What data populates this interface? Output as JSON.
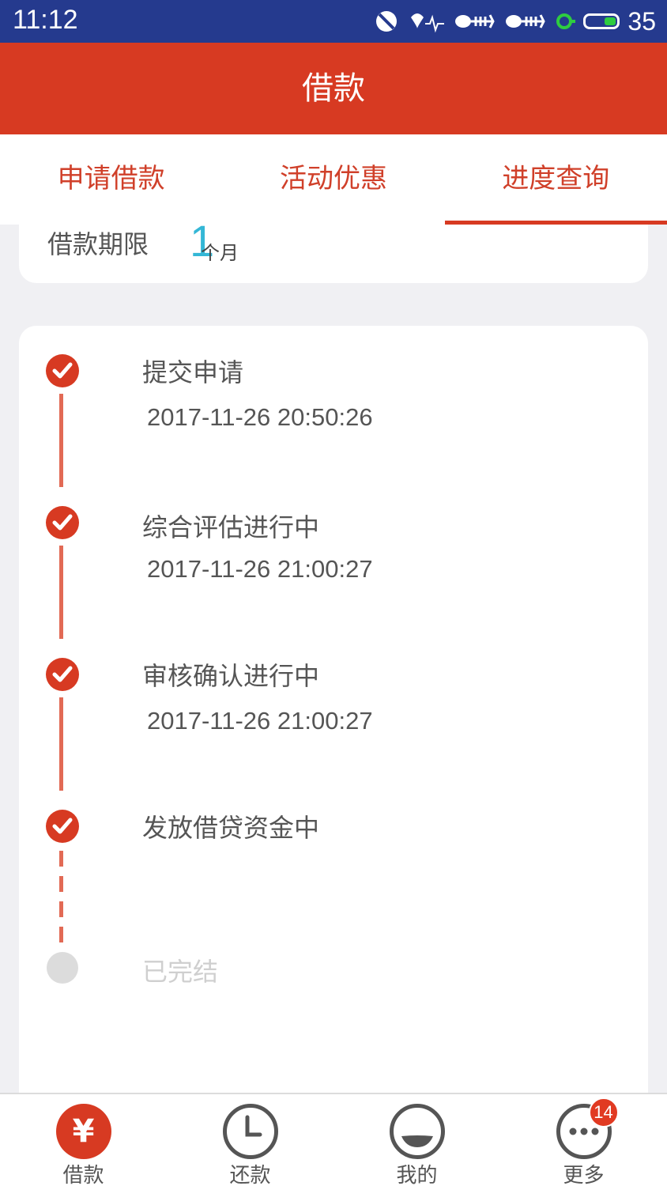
{
  "status_bar": {
    "time": "11:12",
    "battery_level": "35",
    "icons": [
      "signal-icon",
      "wifi-icon",
      "fish-icon",
      "fish-icon",
      "battery-icon"
    ]
  },
  "header": {
    "title": "借款"
  },
  "tabs": [
    {
      "label": "申请借款",
      "active": false
    },
    {
      "label": "活动优惠",
      "active": false
    },
    {
      "label": "进度查询",
      "active": true
    }
  ],
  "loan_term": {
    "label": "借款期限",
    "value": "1",
    "unit": "个月"
  },
  "progress": {
    "steps": [
      {
        "title": "提交申请",
        "time": "2017-11-26 20:50:26",
        "done": true
      },
      {
        "title": "综合评估进行中",
        "time": "2017-11-26 21:00:27",
        "done": true
      },
      {
        "title": "审核确认进行中",
        "time": "2017-11-26 21:00:27",
        "done": true
      },
      {
        "title": "发放借贷资金中",
        "time": "",
        "done": true
      },
      {
        "title": "已完结",
        "time": "",
        "done": false
      }
    ]
  },
  "bottom_nav": {
    "items": [
      {
        "label": "借款",
        "icon": "yen-icon",
        "glyph": "¥",
        "active": true
      },
      {
        "label": "还款",
        "icon": "clock-icon",
        "active": false
      },
      {
        "label": "我的",
        "icon": "profile-icon",
        "active": false
      },
      {
        "label": "更多",
        "icon": "more-icon",
        "active": false,
        "badge": "14"
      }
    ]
  },
  "colors": {
    "primary": "#d73a22",
    "status_bar": "#253a8e",
    "accent_value": "#34b7d6",
    "background": "#f0f0f3"
  }
}
